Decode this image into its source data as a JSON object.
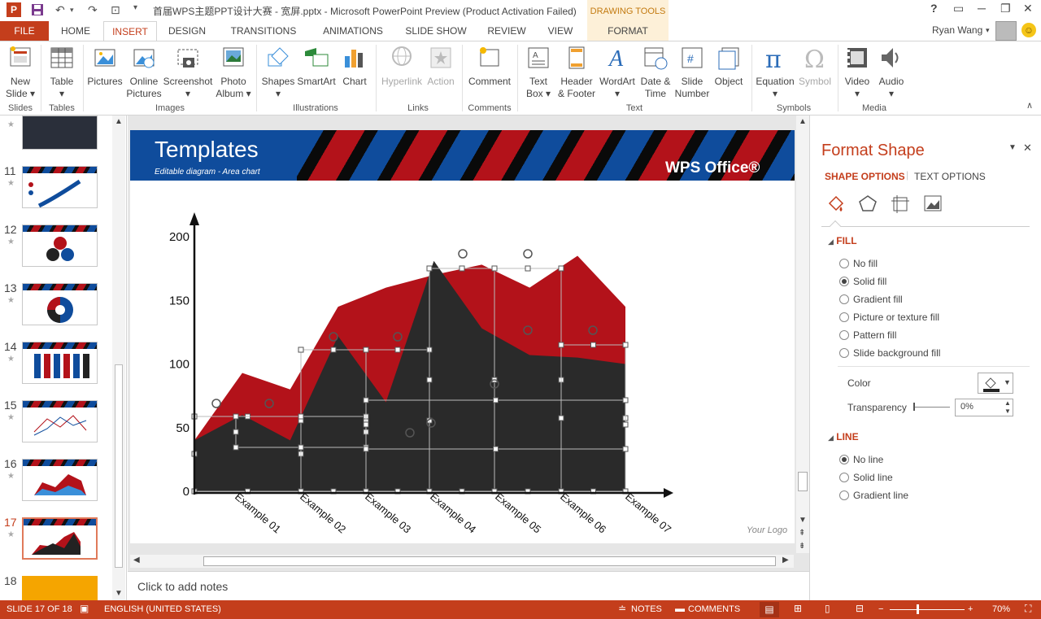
{
  "app": {
    "logo_text": "P",
    "document_title": "首届WPS主题PPT设计大赛 - 宽屏.pptx - Microsoft PowerPoint Preview (Product Activation Failed)",
    "contextual_group": "DRAWING TOOLS",
    "window_controls": [
      "?",
      "▭",
      "─",
      "❐",
      "✕"
    ]
  },
  "tabs": [
    {
      "label": "FILE"
    },
    {
      "label": "HOME"
    },
    {
      "label": "INSERT"
    },
    {
      "label": "DESIGN"
    },
    {
      "label": "TRANSITIONS"
    },
    {
      "label": "ANIMATIONS"
    },
    {
      "label": "SLIDE SHOW"
    },
    {
      "label": "REVIEW"
    },
    {
      "label": "VIEW"
    },
    {
      "label": "FORMAT"
    }
  ],
  "user": {
    "name": "Ryan Wang"
  },
  "ribbon": {
    "buttons": [
      {
        "label": "New\nSlide ▾",
        "icon": "new-slide-icon"
      },
      {
        "label": "Table\n▾",
        "icon": "table-icon"
      },
      {
        "label": "Pictures",
        "icon": "pictures-icon"
      },
      {
        "label": "Online\nPictures",
        "icon": "online-pictures-icon"
      },
      {
        "label": "Screenshot\n▾",
        "icon": "screenshot-icon"
      },
      {
        "label": "Photo\nAlbum ▾",
        "icon": "photo-album-icon"
      },
      {
        "label": "Shapes\n▾",
        "icon": "shapes-icon"
      },
      {
        "label": "SmartArt",
        "icon": "smartart-icon"
      },
      {
        "label": "Chart",
        "icon": "chart-icon"
      },
      {
        "label": "Hyperlink",
        "icon": "hyperlink-icon"
      },
      {
        "label": "Action",
        "icon": "action-icon"
      },
      {
        "label": "Comment",
        "icon": "comment-icon"
      },
      {
        "label": "Text\nBox ▾",
        "icon": "text-box-icon"
      },
      {
        "label": "Header\n& Footer",
        "icon": "header-footer-icon"
      },
      {
        "label": "WordArt\n▾",
        "icon": "wordart-icon"
      },
      {
        "label": "Date &\nTime",
        "icon": "date-time-icon"
      },
      {
        "label": "Slide\nNumber",
        "icon": "slide-number-icon"
      },
      {
        "label": "Object",
        "icon": "object-icon"
      },
      {
        "label": "Equation\n▾",
        "icon": "equation-icon"
      },
      {
        "label": "Symbol",
        "icon": "symbol-icon"
      },
      {
        "label": "Video\n▾",
        "icon": "video-icon"
      },
      {
        "label": "Audio\n▾",
        "icon": "audio-icon"
      }
    ],
    "groups": [
      "Slides",
      "Tables",
      "Images",
      "Illustrations",
      "Links",
      "Comments",
      "Text",
      "Symbols",
      "Media"
    ]
  },
  "thumbnails": [
    {
      "number": "",
      "star": "★"
    },
    {
      "number": "11",
      "star": "★"
    },
    {
      "number": "12",
      "star": "★"
    },
    {
      "number": "13",
      "star": "★"
    },
    {
      "number": "14",
      "star": "★"
    },
    {
      "number": "15",
      "star": "★"
    },
    {
      "number": "16",
      "star": "★"
    },
    {
      "number": "17",
      "star": "★"
    },
    {
      "number": "18",
      "star": ""
    }
  ],
  "slide": {
    "title": "Templates",
    "subtitle": "Editable diagram - Area chart",
    "brand": "WPS Office®",
    "logo_placeholder": "Your Logo"
  },
  "chart_data": {
    "type": "area",
    "categories": [
      "Example 01",
      "Example 02",
      "Example 03",
      "Example 04",
      "Example 05",
      "Example 06",
      "Example 07"
    ],
    "series": [
      {
        "color": "#b3121a",
        "values": [
          40,
          93,
          80,
          145,
          160,
          170,
          178,
          160,
          185,
          145
        ]
      },
      {
        "color": "#2a2a2a",
        "values": [
          40,
          60,
          40,
          122,
          70,
          181,
          128,
          107,
          105,
          100
        ]
      }
    ],
    "x": [
      0,
      1,
      2,
      3,
      4,
      5,
      6,
      7,
      8,
      9
    ],
    "ylim": [
      0,
      200
    ],
    "yticks": [
      "0",
      "50",
      "100",
      "150",
      "200"
    ]
  },
  "notes": {
    "placeholder": "Click to add notes"
  },
  "format_pane": {
    "title": "Format Shape",
    "tabs": [
      "SHAPE OPTIONS",
      "TEXT OPTIONS"
    ],
    "fill_section": "FILL",
    "fill_options": [
      {
        "label": "No fill",
        "selected": false
      },
      {
        "label": "Solid fill",
        "selected": true
      },
      {
        "label": "Gradient fill",
        "selected": false
      },
      {
        "label": "Picture or texture fill",
        "selected": false
      },
      {
        "label": "Pattern fill",
        "selected": false
      },
      {
        "label": "Slide background fill",
        "selected": false
      }
    ],
    "color_label": "Color",
    "transparency_label": "Transparency",
    "transparency_value": "0%",
    "line_section": "LINE",
    "line_options": [
      {
        "label": "No line",
        "selected": true
      },
      {
        "label": "Solid line",
        "selected": false
      },
      {
        "label": "Gradient line",
        "selected": false
      }
    ]
  },
  "statusbar": {
    "slide_info": "SLIDE 17 OF 18",
    "language": "ENGLISH (UNITED STATES)",
    "notes": "NOTES",
    "comments": "COMMENTS",
    "zoom": "70%"
  }
}
